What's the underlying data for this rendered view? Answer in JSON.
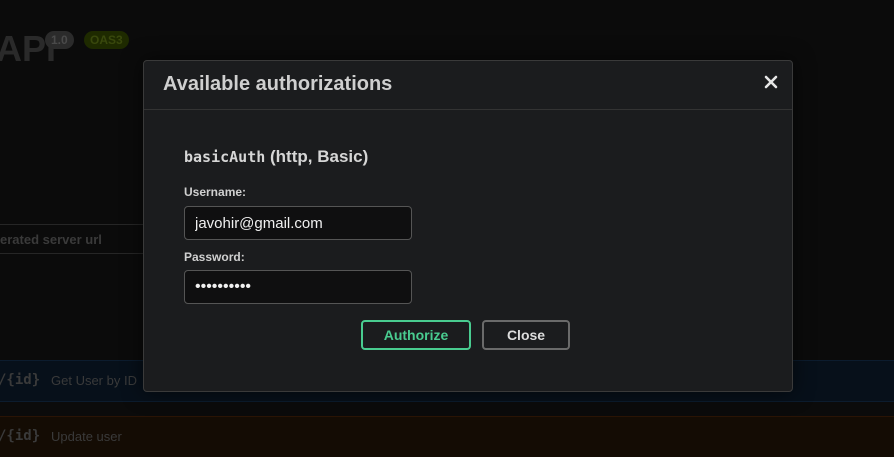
{
  "background": {
    "title": "API",
    "version_badge": "1.0",
    "oas_badge": "OAS3",
    "server_text": "erated server url",
    "operations": [
      {
        "path": "/{id}",
        "summary": "Get User by ID"
      },
      {
        "path": "/{id}",
        "summary": "Update user"
      }
    ]
  },
  "modal": {
    "title": "Available authorizations",
    "close_icon": "close-x-icon",
    "scheme_name": "basicAuth",
    "scheme_type": "(http, Basic)",
    "username_label": "Username:",
    "username_value": "javohir@gmail.com",
    "password_label": "Password:",
    "password_value": "••••••••••",
    "authorize_label": "Authorize",
    "close_label": "Close"
  },
  "colors": {
    "authorize": "#49cc90",
    "modal_bg": "#1b1c1e"
  }
}
